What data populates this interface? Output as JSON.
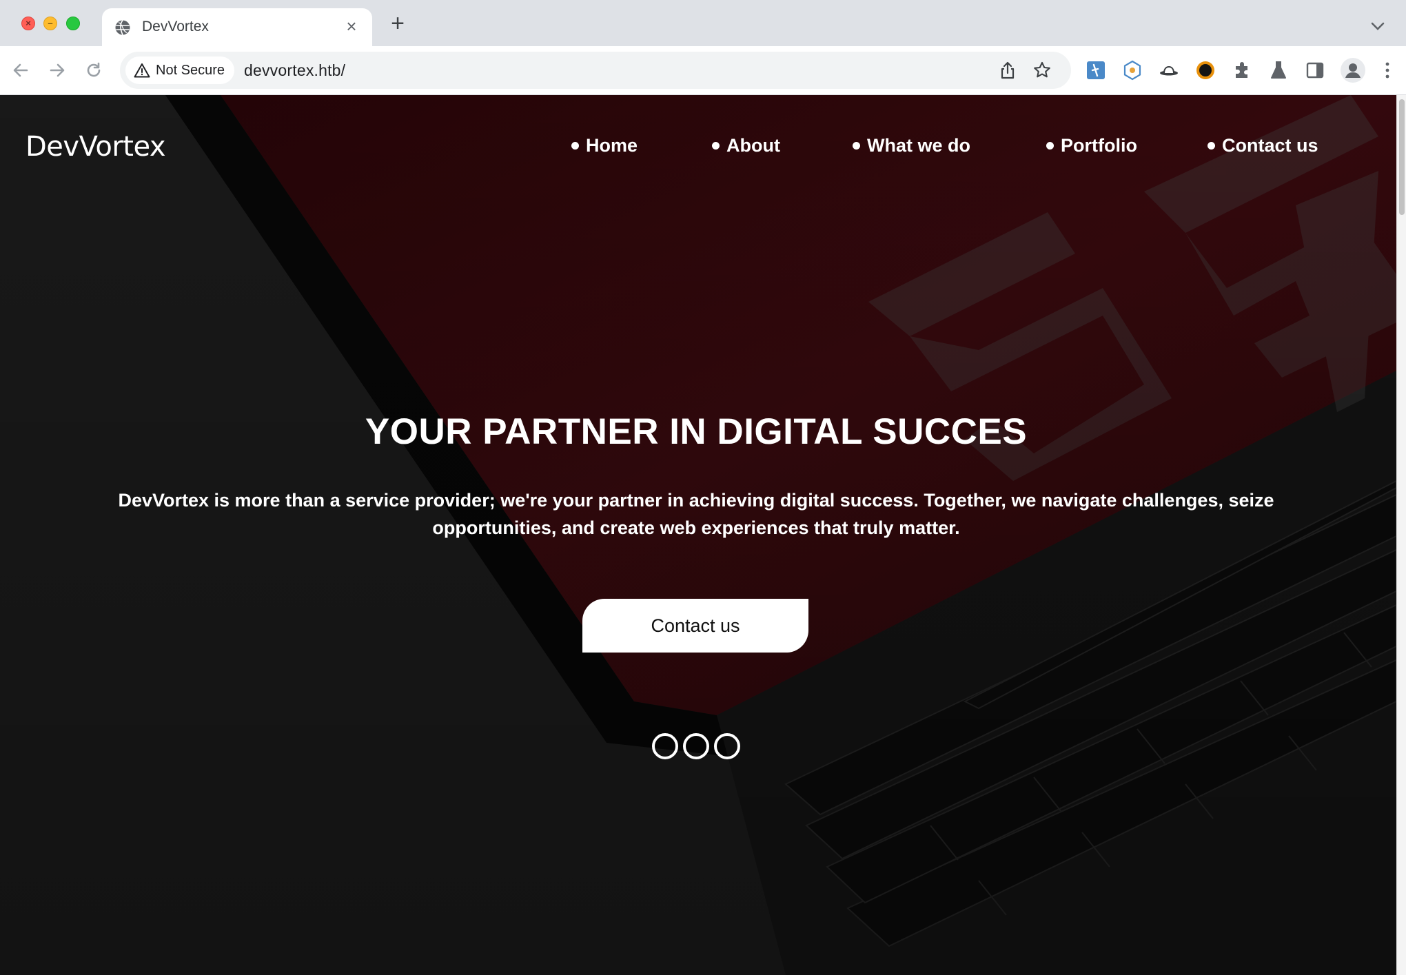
{
  "browser": {
    "tab_title": "DevVortex",
    "security_label": "Not Secure",
    "url": "devvortex.htb/"
  },
  "site": {
    "brand": "DevVortex",
    "nav": [
      "Home",
      "About",
      "What we do",
      "Portfolio",
      "Contact us"
    ],
    "hero": {
      "title": "YOUR PARTNER IN DIGITAL SUCCES",
      "text": "DevVortex is more than a service provider; we're your partner in achieving digital success. Together, we navigate challenges, seize opportunities, and create web experiences that truly matter.",
      "button": "Contact us",
      "slide_count": 3
    }
  },
  "colors": {
    "hero_text": "#ffffff",
    "hero_background": "#1c1c1c",
    "hero_accent_red": "#3a0a0e"
  },
  "icons": {
    "tab": "globe-icon",
    "security": "warning-triangle-icon",
    "omnibox": [
      "share-icon",
      "bookmark-star-icon"
    ],
    "extensions": [
      "extension-translate-icon",
      "extension-hexagon-icon",
      "extension-hat-icon",
      "extension-circle-icon",
      "extensions-puzzle-icon",
      "labs-flask-icon",
      "side-panel-icon",
      "profile-avatar-icon",
      "chrome-menu-icon"
    ]
  }
}
